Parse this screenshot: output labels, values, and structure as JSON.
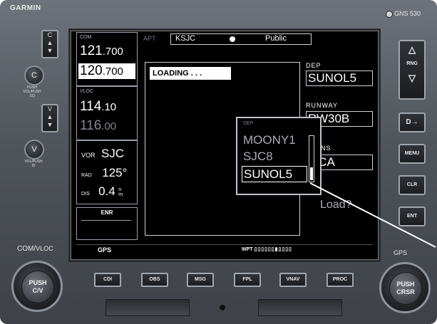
{
  "device": {
    "brand": "GARMIN",
    "model": "GNS 530"
  },
  "left_controls": {
    "com_flip_label": "C",
    "com_knob_label": "C",
    "com_knob_caption": [
      "PUSH",
      "VOL/PUSH",
      "SQ"
    ],
    "vloc_flip_label": "V",
    "vloc_knob_label": "V",
    "vloc_knob_caption": [
      "VOL/PUSH",
      "ID"
    ],
    "com_vloc_label_a": "COM/",
    "com_vloc_label_b": "VLOC",
    "big_knob_lines": [
      "PUSH",
      "C/V"
    ]
  },
  "screen": {
    "com": {
      "label": "COM",
      "active_main": "121",
      "active_dec": ".700",
      "standby_main": "120",
      "standby_dec": ".700"
    },
    "vloc": {
      "label": "VLOC",
      "active_main": "114",
      "active_dec": ".10",
      "standby_main": "116",
      "standby_dec": ".00"
    },
    "nav": {
      "vor_label": "VOR",
      "vor_value": "SJC",
      "rad_label": "RAD",
      "rad_value": "125°",
      "dis_label": "DIS",
      "dis_value": "0.4",
      "dis_unit_top": "n",
      "dis_unit_bottom": "m"
    },
    "mode": "ENR",
    "apt_label": "APT",
    "apt_value": "KSJC",
    "apt_type": "Public",
    "loading_text": "LOADING . . .",
    "dep_label": "DEP",
    "dep_value": "SUNOL5",
    "runway_label": "RUNWAY",
    "runway_value": "RW30B",
    "trans_label": "TRANS",
    "trans_value": "MCA",
    "load_text": "Load?",
    "popup": {
      "title": "DEP",
      "items": [
        "MOONY1",
        "SJC8",
        "SUNOL5"
      ],
      "selected_index": 2
    },
    "status_bar": {
      "left": "GPS",
      "wpt_label": "WPT"
    }
  },
  "right_controls": {
    "rng_label": "RNG",
    "direct_label": "D→",
    "menu_label": "MENU",
    "clr_label": "CLR",
    "ent_label": "ENT",
    "gps_label": "GPS",
    "big_knob_lines": [
      "PUSH",
      "CRSR"
    ]
  },
  "bottom_buttons": [
    "CDI",
    "OBS",
    "MSG",
    "FPL",
    "VNAV",
    "PROC"
  ]
}
